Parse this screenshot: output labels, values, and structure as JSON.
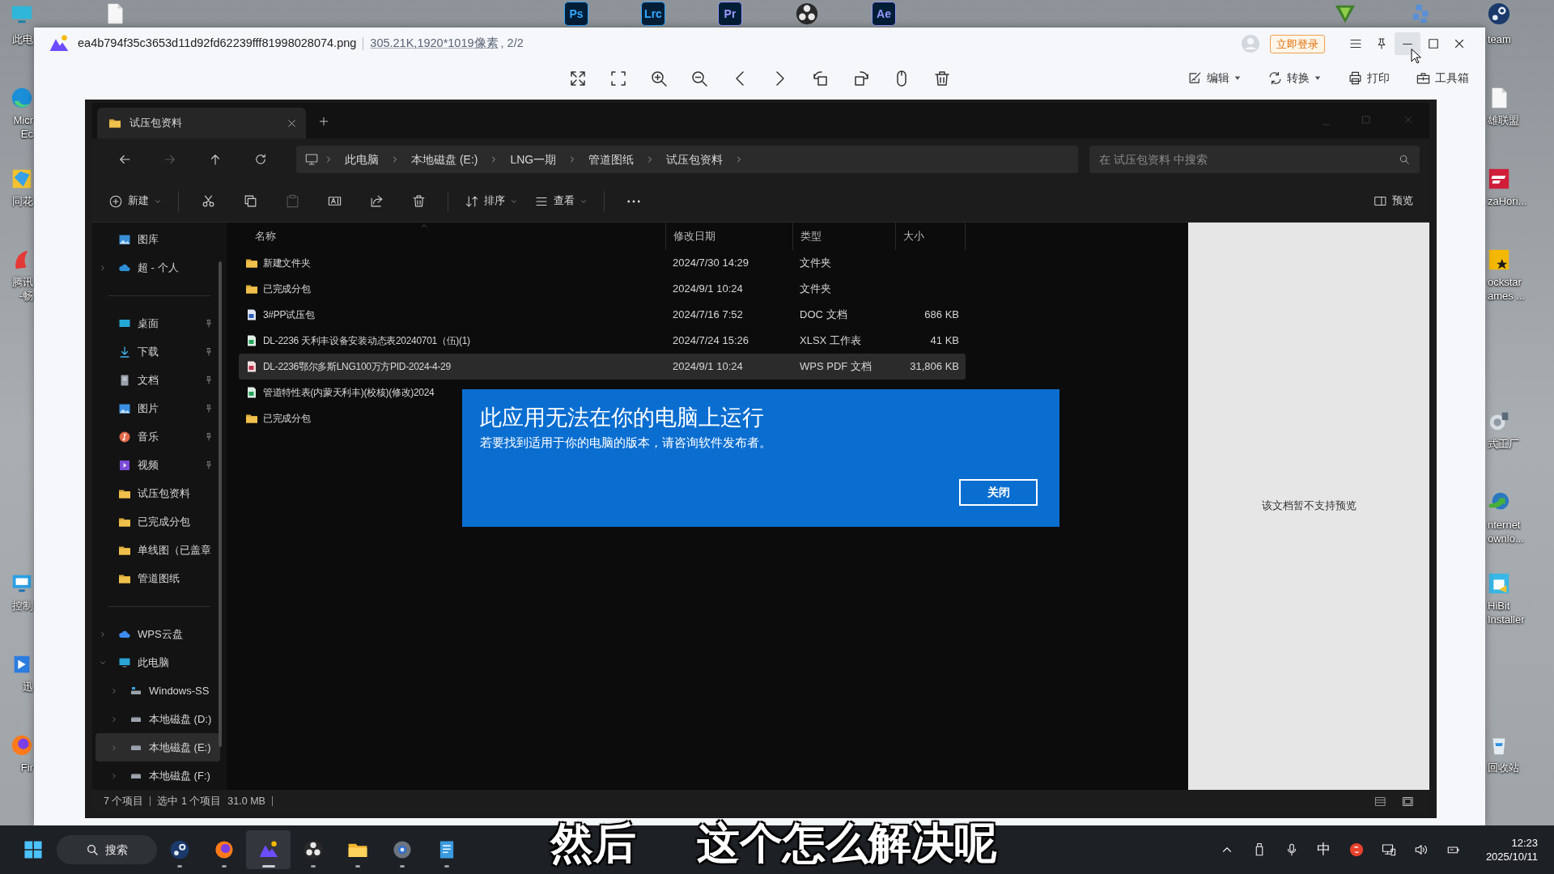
{
  "desktop": {
    "icons": [
      {
        "kind": "computer",
        "label_lines": [
          "此电"
        ]
      },
      {
        "kind": "file"
      },
      {
        "kind": "adobe",
        "label": "Ps",
        "color": "#31a8ff"
      },
      {
        "kind": "adobe",
        "label": "Lrc",
        "color": "#31a8ff"
      },
      {
        "kind": "adobe",
        "label": "Pr",
        "color": "#9999ff"
      },
      {
        "kind": "obs"
      },
      {
        "kind": "adobe",
        "label": "Ae",
        "color": "#9999ff"
      },
      {
        "kind": "emblem"
      },
      {
        "kind": "pixel"
      },
      {
        "kind": "steam",
        "label_lines": [
          "team"
        ]
      },
      {
        "kind": "edge",
        "label_lines": [
          "Micr",
          "Ec"
        ]
      },
      {
        "kind": "stock",
        "label_lines": [
          "同花"
        ]
      },
      {
        "kind": "tencent",
        "label_lines": [
          "腾讯",
          "-畅"
        ]
      },
      {
        "kind": "control",
        "label_lines": [
          "控制"
        ]
      },
      {
        "kind": "bird",
        "label_lines": [
          "迅"
        ]
      },
      {
        "kind": "firefox",
        "label_lines": [
          "Fir"
        ]
      },
      {
        "kind": "file",
        "label_lines": [
          "雄联盟"
        ]
      },
      {
        "kind": "racing",
        "label_lines": [
          "zaHori..."
        ]
      },
      {
        "kind": "star",
        "label_lines": [
          "ockstar",
          "ames ..."
        ]
      },
      {
        "kind": "factory",
        "label_lines": [
          "式工厂"
        ]
      },
      {
        "kind": "globe",
        "label_lines": [
          "nternet",
          "ownlo..."
        ]
      },
      {
        "kind": "installer",
        "label_lines": [
          "HiBit",
          "Installer"
        ]
      },
      {
        "kind": "recycle",
        "label_lines": [
          "回收站"
        ]
      }
    ]
  },
  "viewer": {
    "file_name": "ea4b794f35c3653d11d92fd62239fff81998028074.png",
    "file_size": "305.21K",
    "dimensions": ",1920*1019像素",
    "page": ", 2/2",
    "login": "立即登录",
    "window_controls": [
      {
        "kind": "menu",
        "hovered": false
      },
      {
        "kind": "pin",
        "hovered": false
      },
      {
        "kind": "minimize",
        "hovered": true
      },
      {
        "kind": "maximize",
        "hovered": false
      },
      {
        "kind": "close",
        "hovered": false
      }
    ],
    "tools": [
      {
        "kind": "fullscreen"
      },
      {
        "kind": "fit"
      },
      {
        "kind": "zoom-in"
      },
      {
        "kind": "zoom-out"
      },
      {
        "kind": "previous"
      },
      {
        "kind": "next"
      },
      {
        "kind": "rotate-left"
      },
      {
        "kind": "rotate-right"
      },
      {
        "kind": "mouse"
      },
      {
        "kind": "delete"
      }
    ],
    "actions": [
      {
        "kind": "edit",
        "label": "编辑",
        "dropdown": true
      },
      {
        "kind": "convert",
        "label": "转换",
        "dropdown": true
      },
      {
        "kind": "print",
        "label": "打印",
        "dropdown": false
      },
      {
        "kind": "toolbox",
        "label": "工具箱",
        "dropdown": false
      }
    ]
  },
  "explorer": {
    "tab": "试压包资料",
    "breadcrumbs": [
      "此电脑",
      "本地磁盘 (E:)",
      "LNG一期",
      "管道图纸",
      "试压包资料"
    ],
    "search": {
      "placeholder": "在 试压包资料 中搜索"
    },
    "new_label": "新建",
    "commands": [
      {
        "kind": "cut",
        "disabled": false
      },
      {
        "kind": "copy",
        "disabled": false
      },
      {
        "kind": "paste",
        "disabled": true
      },
      {
        "kind": "rename",
        "disabled": false
      },
      {
        "kind": "share",
        "disabled": false
      },
      {
        "kind": "delete",
        "disabled": false
      }
    ],
    "sort_label": "排序",
    "view_label": "查看",
    "preview_label": "预览",
    "nav": [
      {
        "items": [
          {
            "kind": "gallery",
            "label": "图库",
            "selected": false
          },
          {
            "kind": "cloud",
            "label": "超 - 个人",
            "selected": false,
            "expanded": false
          }
        ]
      },
      {
        "items": [
          {
            "kind": "desktop",
            "label": "桌面",
            "selected": false,
            "pinned": true
          },
          {
            "kind": "download",
            "label": "下载",
            "selected": false,
            "pinned": true
          },
          {
            "kind": "documents",
            "label": "文档",
            "selected": false,
            "pinned": true
          },
          {
            "kind": "pictures",
            "label": "图片",
            "selected": false,
            "pinned": true
          },
          {
            "kind": "music",
            "label": "音乐",
            "selected": false,
            "pinned": true
          },
          {
            "kind": "videos",
            "label": "视频",
            "selected": false,
            "pinned": true
          },
          {
            "kind": "folder",
            "label": "试压包资料",
            "selected": false
          },
          {
            "kind": "folder",
            "label": "已完成分包",
            "selected": false
          },
          {
            "kind": "folder",
            "label": "单线图（已盖章",
            "selected": false
          },
          {
            "kind": "folder",
            "label": "管道图纸",
            "selected": false
          }
        ]
      },
      {
        "items": [
          {
            "kind": "wps-cloud",
            "label": "WPS云盘",
            "selected": false,
            "expanded": false
          },
          {
            "kind": "pc",
            "label": "此电脑",
            "selected": false,
            "expanded": true,
            "children": [
              {
                "kind": "system-drive",
                "label": "Windows-SS",
                "selected": false,
                "expanded": false
              },
              {
                "kind": "drive",
                "label": "本地磁盘 (D:)",
                "selected": false,
                "expanded": false
              },
              {
                "kind": "drive",
                "label": "本地磁盘 (E:)",
                "selected": true,
                "expanded": false
              },
              {
                "kind": "drive",
                "label": "本地磁盘 (F:)",
                "selected": false,
                "expanded": false
              }
            ]
          }
        ]
      }
    ],
    "columns": [
      "名称",
      "修改日期",
      "类型",
      "大小"
    ],
    "rows": [
      {
        "kind": "folder",
        "name": "新建文件夹",
        "date": "2024/7/30 14:29",
        "type": "文件夹",
        "selected": false
      },
      {
        "kind": "folder",
        "name": "已完成分包",
        "date": "2024/9/1 10:24",
        "type": "文件夹",
        "selected": false
      },
      {
        "kind": "doc",
        "name": "3#PP试压包",
        "date": "2024/7/16 7:52",
        "type": "DOC 文档",
        "size": "686 KB",
        "selected": false
      },
      {
        "kind": "sheet",
        "name": "DL-2236 天利丰设备安装动态表20240701（伍)(1)",
        "date": "2024/7/24 15:26",
        "type": "XLSX 工作表",
        "size": "41 KB",
        "selected": false
      },
      {
        "kind": "pdf",
        "name": "DL-2236鄂尔多斯LNG100万方PID-2024-4-29",
        "date": "2024/9/1 10:24",
        "type": "WPS PDF 文档",
        "size": "31,806 KB",
        "selected": true
      },
      {
        "kind": "sheet",
        "name": "管道特性表(内蒙天利丰)(校核)(修改)2024",
        "selected": false
      },
      {
        "kind": "folder",
        "name": "已完成分包",
        "selected": false
      }
    ],
    "preview_message": "该文档暂不支持预览",
    "status": {
      "count": "7 个项目",
      "selection": "选中 1 个项目",
      "size": "31.0 MB"
    }
  },
  "dialog": {
    "title": "此应用无法在你的电脑上运行",
    "message": "若要找到适用于你的电脑的版本，请咨询软件发布者。",
    "button": "关闭"
  },
  "taskbar": {
    "search": "搜索",
    "apps": [
      {
        "kind": "steam",
        "active": false,
        "running": true
      },
      {
        "kind": "firefox",
        "active": false,
        "running": true
      },
      {
        "kind": "viewer",
        "active": true,
        "running": true
      },
      {
        "kind": "obs",
        "active": false,
        "running": true
      },
      {
        "kind": "explorer",
        "active": false,
        "running": true
      },
      {
        "kind": "settings",
        "active": false,
        "running": true
      },
      {
        "kind": "notepad",
        "active": false,
        "running": true
      }
    ],
    "tray": [
      {
        "kind": "chevron"
      },
      {
        "kind": "usb"
      },
      {
        "kind": "microphone"
      },
      {
        "kind": "ime",
        "label": "中"
      },
      {
        "kind": "sogou"
      },
      {
        "kind": "network"
      },
      {
        "kind": "volume"
      },
      {
        "kind": "battery"
      }
    ],
    "time": "12:23",
    "date": "2025/10/11"
  },
  "subtitle": [
    "然后",
    "这个怎么解决呢"
  ]
}
